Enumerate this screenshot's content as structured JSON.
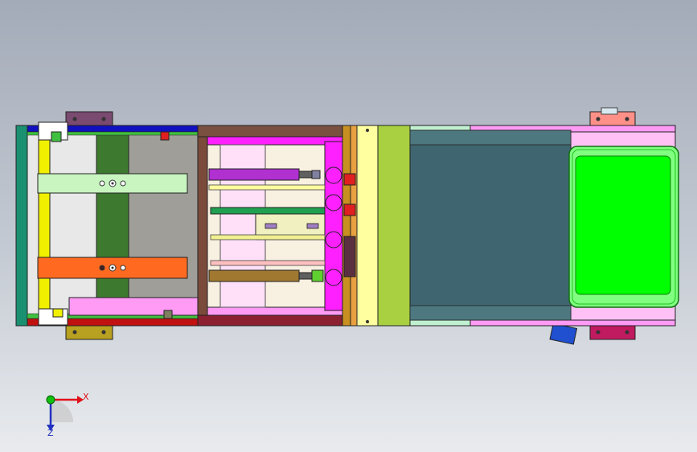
{
  "viewport": {
    "background_top": "#a3abb8",
    "background_bottom": "#e9ebee"
  },
  "triad": {
    "x_label": "X",
    "z_label": "Z",
    "x_color": "#e0101a",
    "z_color": "#2030c0",
    "y_color": "#10c010"
  },
  "colors": {
    "frame_green": "#1a9070",
    "rail_yellow": "#f0f000",
    "rail_blue": "#1010c0",
    "plate_gray": "#a09e98",
    "strip_darkgreen": "#3d7a30",
    "bar_lightgreen": "#c8f5c0",
    "bar_orange": "#ff6a20",
    "pink": "#ff9af5",
    "brown": "#7a4a3a",
    "dark_red": "#8b2030",
    "magenta": "#ff20ff",
    "cylinder_purple": "#b030d0",
    "cylinder_bronze": "#a07830",
    "green_rod": "#30b030",
    "cream": "#ffffa0",
    "olive_green": "#a8d040",
    "hopper_teal": "#3f6670",
    "bright_green": "#00ff00",
    "bracket_mauve": "#7a4a70",
    "bracket_salmon": "#ff9088",
    "bracket_crimson": "#c01a60"
  }
}
